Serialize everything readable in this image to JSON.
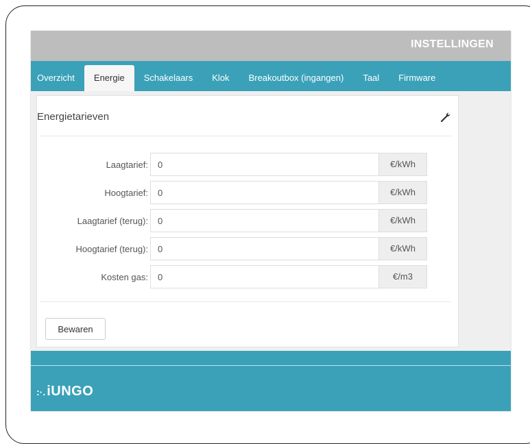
{
  "app": {
    "title": "INSTELLINGEN",
    "logo_dots": ":·.",
    "logo_text": "iUNGO"
  },
  "colors": {
    "accent": "#3aa1b8",
    "topbar": "#bdbdbd"
  },
  "tabs": [
    {
      "label": "Overzicht",
      "active": false
    },
    {
      "label": "Energie",
      "active": true
    },
    {
      "label": "Schakelaars",
      "active": false
    },
    {
      "label": "Klok",
      "active": false
    },
    {
      "label": "Breakoutbox (ingangen)",
      "active": false
    },
    {
      "label": "Taal",
      "active": false
    },
    {
      "label": "Firmware",
      "active": false
    }
  ],
  "panel": {
    "title": "Energietarieven",
    "settings_icon": "wrench-icon",
    "fields": [
      {
        "label": "Laagtarief:",
        "value": "0",
        "unit": "€/kWh"
      },
      {
        "label": "Hoogtarief:",
        "value": "0",
        "unit": "€/kWh"
      },
      {
        "label": "Laagtarief (terug):",
        "value": "0",
        "unit": "€/kWh"
      },
      {
        "label": "Hoogtarief (terug):",
        "value": "0",
        "unit": "€/kWh"
      },
      {
        "label": "Kosten gas:",
        "value": "0",
        "unit": "€/m3"
      }
    ],
    "save_label": "Bewaren"
  }
}
